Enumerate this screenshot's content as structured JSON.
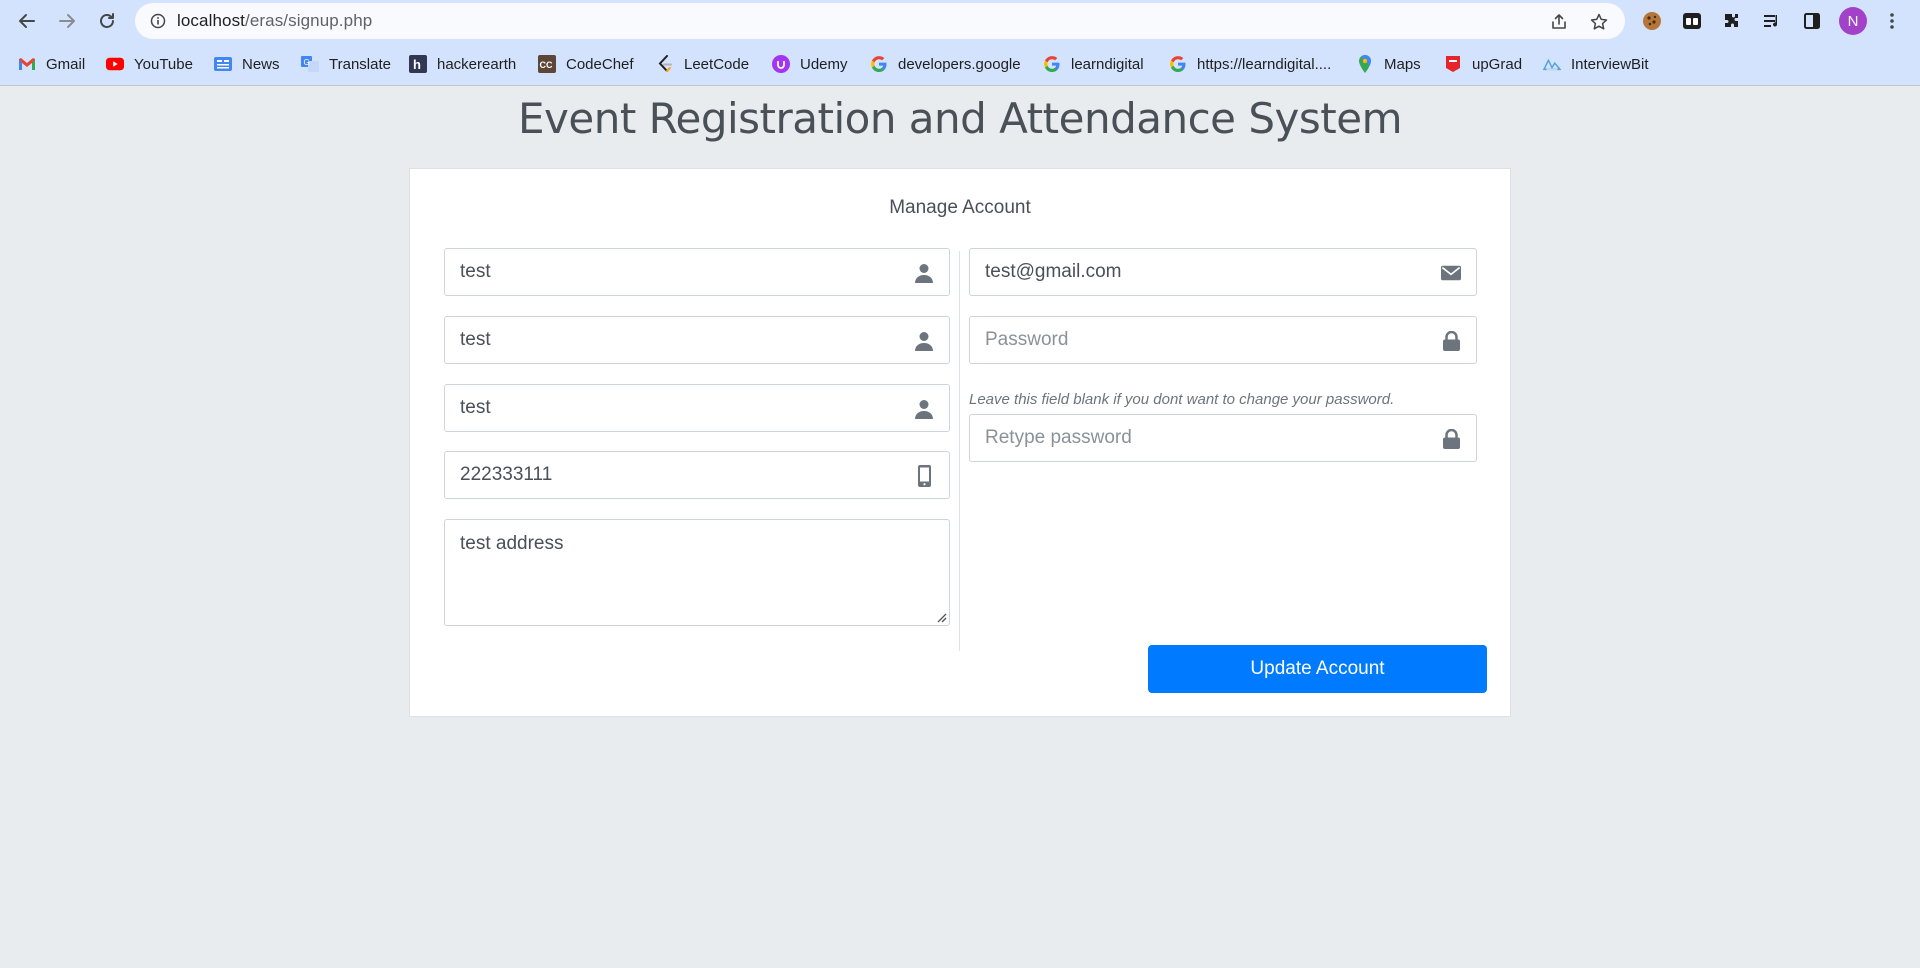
{
  "browser": {
    "url_host": "localhost",
    "url_path": "/eras/signup.php",
    "avatar_initial": "N",
    "bookmarks": [
      {
        "label": "Gmail",
        "icon": "gmail-icon"
      },
      {
        "label": "YouTube",
        "icon": "youtube-icon"
      },
      {
        "label": "News",
        "icon": "news-icon"
      },
      {
        "label": "Translate",
        "icon": "translate-icon"
      },
      {
        "label": "hackerearth",
        "icon": "hackerearth-icon"
      },
      {
        "label": "CodeChef",
        "icon": "codechef-icon"
      },
      {
        "label": "LeetCode",
        "icon": "leetcode-icon"
      },
      {
        "label": "Udemy",
        "icon": "udemy-icon"
      },
      {
        "label": "developers.google",
        "icon": "google-icon"
      },
      {
        "label": "learndigital",
        "icon": "google-icon"
      },
      {
        "label": "https://learndigital....",
        "icon": "google-icon"
      },
      {
        "label": "Maps",
        "icon": "maps-icon"
      },
      {
        "label": "upGrad",
        "icon": "upgrad-icon"
      },
      {
        "label": "InterviewBit",
        "icon": "interviewbit-icon"
      }
    ]
  },
  "page": {
    "title": "Event Registration and Attendance System",
    "card_heading": "Manage Account"
  },
  "form": {
    "first_name": {
      "value": "test",
      "icon": "user-icon"
    },
    "middle_name": {
      "value": "test",
      "icon": "user-icon"
    },
    "last_name": {
      "value": "test",
      "icon": "user-icon"
    },
    "phone": {
      "value": "222333111",
      "icon": "mobile-icon"
    },
    "address": {
      "value": "test address"
    },
    "email": {
      "value": "test@gmail.com",
      "icon": "envelope-icon"
    },
    "password": {
      "value": "",
      "placeholder": "Password",
      "icon": "lock-icon"
    },
    "password_hint": "Leave this field blank if you dont want to change your password.",
    "retype_password": {
      "value": "",
      "placeholder": "Retype password",
      "icon": "lock-icon"
    },
    "submit_label": "Update Account"
  },
  "colors": {
    "primary": "#007bff",
    "page_bg": "#e9ecef",
    "chrome_bg": "#d3e3fd",
    "icon_gray": "#6c757d"
  }
}
